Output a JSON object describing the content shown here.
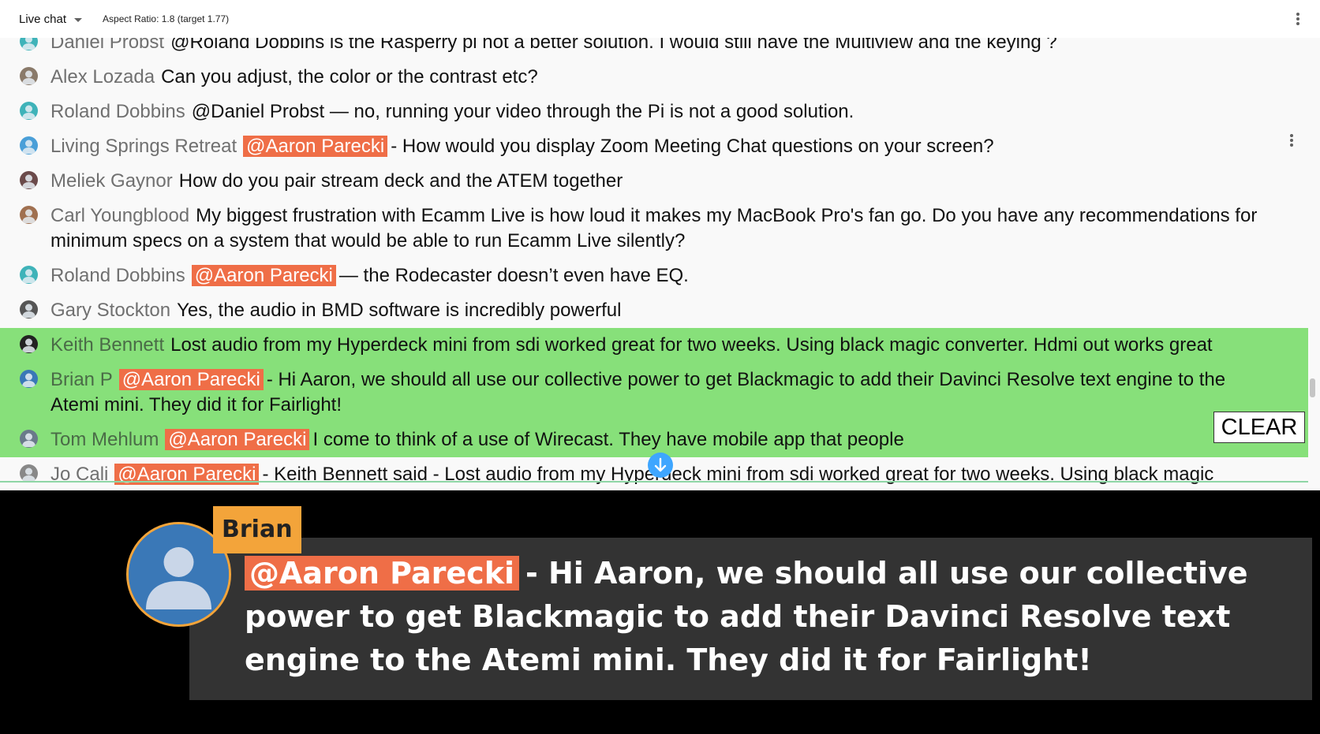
{
  "header": {
    "chat_mode": "Live chat",
    "aspect_ratio": "Aspect Ratio: 1.8 (target 1.77)"
  },
  "messages": [
    {
      "author": "Daniel Probst",
      "mention": "",
      "text": "@Roland Dobbins is the Rasperry pi not a better solution. I would still have the Multiview and the keying ?",
      "highlighted": false,
      "avatar_color": "#3fb3b9"
    },
    {
      "author": "Alex Lozada",
      "mention": "",
      "text": "Can you adjust, the color or the contrast etc?",
      "highlighted": false,
      "avatar_color": "#8a7a6a"
    },
    {
      "author": "Roland Dobbins",
      "mention": "",
      "text": "@Daniel Probst — no, running your video through the Pi is not a good solution.",
      "highlighted": false,
      "avatar_color": "#3fb3b9"
    },
    {
      "author": "Living Springs Retreat",
      "mention": "@Aaron Parecki",
      "text": "- How would you display Zoom Meeting Chat questions on your screen?",
      "highlighted": false,
      "avatar_color": "#4a9fd8"
    },
    {
      "author": "Meliek Gaynor",
      "mention": "",
      "text": "How do you pair stream deck and the ATEM together",
      "highlighted": false,
      "avatar_color": "#6b4a4a"
    },
    {
      "author": "Carl Youngblood",
      "mention": "",
      "text": "My biggest frustration with Ecamm Live is how loud it makes my MacBook Pro's fan go. Do you have any recommendations for minimum specs on a system that would be able to run Ecamm Live silently?",
      "highlighted": false,
      "avatar_color": "#a07050"
    },
    {
      "author": "Roland Dobbins",
      "mention": "@Aaron Parecki",
      "text": "— the Rodecaster doesn’t even have EQ.",
      "highlighted": false,
      "avatar_color": "#3fb3b9"
    },
    {
      "author": "Gary Stockton",
      "mention": "",
      "text": "Yes, the audio in BMD software is incredibly powerful",
      "highlighted": false,
      "avatar_color": "#555555"
    },
    {
      "author": "Keith Bennett",
      "mention": "",
      "text": "Lost audio from my Hyperdeck mini from sdi worked great for two weeks. Using black magic converter. Hdmi out works great",
      "highlighted": true,
      "avatar_color": "#222222"
    },
    {
      "author": "Brian P",
      "mention": "@Aaron Parecki",
      "text": "- Hi Aaron, we should all use our collective power to get Blackmagic to add their Davinci Resolve text engine to the Atemi mini. They did it for Fairlight!",
      "highlighted": true,
      "avatar_color": "#3a78b7"
    },
    {
      "author": "Tom Mehlum",
      "mention": "@Aaron Parecki",
      "text": "I come to think of a use of Wirecast. They have mobile app that people",
      "highlighted": true,
      "avatar_color": "#6a7a8a"
    },
    {
      "author": "Jo Cali",
      "mention": "@Aaron Parecki",
      "text": "- Keith Bennett said - Lost audio from my Hyperdeck mini from sdi worked great for two weeks. Using black magic converter. Hdmi out works great",
      "highlighted": false,
      "avatar_color": "#888888"
    }
  ],
  "controls": {
    "clear_label": "CLEAR",
    "scroll_down_icon": "arrow-down-icon",
    "menu_icon": "more-vert-icon"
  },
  "overlay": {
    "name": "Brian",
    "mention": "@Aaron Parecki",
    "text": "- Hi Aaron, we should all use our collective power to get Blackmagic to add their Davinci Resolve text engine to the Atemi mini. They did it for Fairlight!"
  },
  "colors": {
    "highlight": "#87e07a",
    "mention": "#ef6e47",
    "overlay_accent": "#f3a43a",
    "overlay_box": "#333333",
    "scroll_button": "#3ea6ff"
  }
}
